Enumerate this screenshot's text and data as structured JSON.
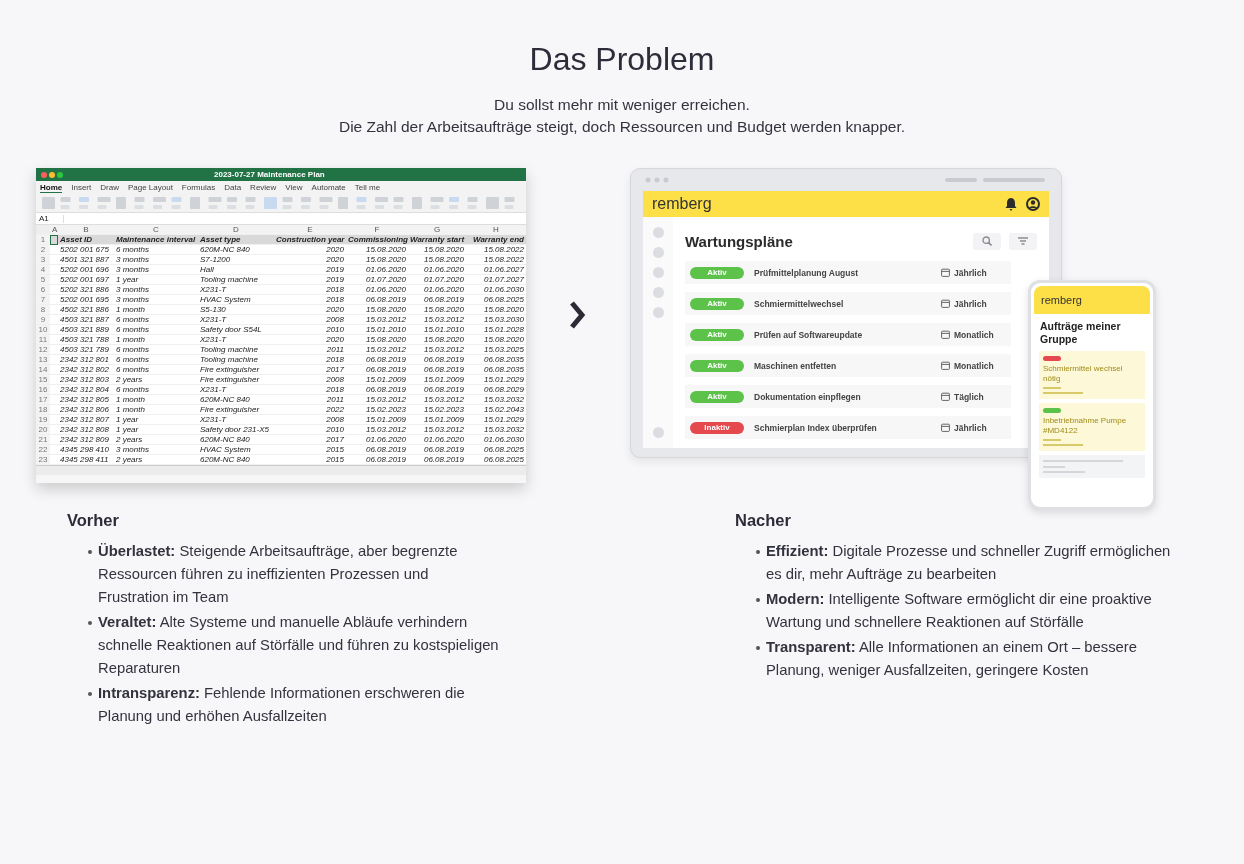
{
  "heading": "Das Problem",
  "intro": [
    "Du sollst mehr mit weniger erreichen.",
    "Die Zahl der Arbeitsaufträge steigt, doch Ressourcen und Budget werden knapper."
  ],
  "spreadsheet": {
    "title": "2023-07-27 Maintenance Plan",
    "ribbon_tabs": [
      {
        "label": "Home",
        "selected": true
      },
      {
        "label": "Insert",
        "selected": false
      },
      {
        "label": "Draw",
        "selected": false
      },
      {
        "label": "Page Layout",
        "selected": false
      },
      {
        "label": "Formulas",
        "selected": false
      },
      {
        "label": "Data",
        "selected": false
      },
      {
        "label": "Review",
        "selected": false
      },
      {
        "label": "View",
        "selected": false
      },
      {
        "label": "Automate",
        "selected": false
      },
      {
        "label": "Tell me",
        "selected": false
      }
    ],
    "cell_ref": "A1",
    "columns": [
      "A",
      "B",
      "C",
      "D",
      "E",
      "F",
      "G",
      "H"
    ],
    "header": {
      "number": "1",
      "cells": [
        "",
        "Asset ID",
        "Maintenance interval",
        "Asset type",
        "Construction year",
        "Commissioning",
        "Warranty start",
        "Warranty end"
      ]
    },
    "rows": [
      {
        "number": "2",
        "cells": [
          "",
          "5202 001 675",
          "6 months",
          "620M-NC 840",
          "2020",
          "15.08.2020",
          "15.08.2020",
          "15.08.2022"
        ]
      },
      {
        "number": "3",
        "cells": [
          "",
          "4501 321 887",
          "3 months",
          "S7-1200",
          "2020",
          "15.08.2020",
          "15.08.2020",
          "15.08.2022"
        ]
      },
      {
        "number": "4",
        "cells": [
          "",
          "5202 001 696",
          "3 months",
          "Hall",
          "2019",
          "01.06.2020",
          "01.06.2020",
          "01.06.2027"
        ]
      },
      {
        "number": "5",
        "cells": [
          "",
          "5202 001 697",
          "1 year",
          "Tooling machine",
          "2019",
          "01.07.2020",
          "01.07.2020",
          "01.07.2027"
        ]
      },
      {
        "number": "6",
        "cells": [
          "",
          "5202 321 886",
          "3 months",
          "X231-T",
          "2018",
          "01.06.2020",
          "01.06.2020",
          "01.06.2030"
        ]
      },
      {
        "number": "7",
        "cells": [
          "",
          "5202 001 695",
          "3 months",
          "HVAC System",
          "2018",
          "06.08.2019",
          "06.08.2019",
          "06.08.2025"
        ]
      },
      {
        "number": "8",
        "cells": [
          "",
          "4502 321 886",
          "1 month",
          "S5-130",
          "2020",
          "15.08.2020",
          "15.08.2020",
          "15.08.2020"
        ]
      },
      {
        "number": "9",
        "cells": [
          "",
          "4503 321 887",
          "6 months",
          "X231-T",
          "2008",
          "15.03.2012",
          "15.03.2012",
          "15.03.2030"
        ]
      },
      {
        "number": "10",
        "cells": [
          "",
          "4503 321 889",
          "6 months",
          "Safety door S54L",
          "2010",
          "15.01.2010",
          "15.01.2010",
          "15.01.2028"
        ]
      },
      {
        "number": "11",
        "cells": [
          "",
          "4503 321 788",
          "1 month",
          "X231-T",
          "2020",
          "15.08.2020",
          "15.08.2020",
          "15.08.2020"
        ]
      },
      {
        "number": "12",
        "cells": [
          "",
          "4503 321 789",
          "6 months",
          "Tooling machine",
          "2011",
          "15.03.2012",
          "15.03.2012",
          "15.03.2025"
        ]
      },
      {
        "number": "13",
        "cells": [
          "",
          "2342 312 801",
          "6 months",
          "Tooling machine",
          "2018",
          "06.08.2019",
          "06.08.2019",
          "06.08.2035"
        ]
      },
      {
        "number": "14",
        "cells": [
          "",
          "2342 312 802",
          "6 months",
          "Fire extinguisher",
          "2017",
          "06.08.2019",
          "06.08.2019",
          "06.08.2035"
        ]
      },
      {
        "number": "15",
        "cells": [
          "",
          "2342 312 803",
          "2 years",
          "Fire extinguisher",
          "2008",
          "15.01.2009",
          "15.01.2009",
          "15.01.2029"
        ]
      },
      {
        "number": "16",
        "cells": [
          "",
          "2342 312 804",
          "6 months",
          "X231-T",
          "2018",
          "06.08.2019",
          "06.08.2019",
          "06.08.2029"
        ]
      },
      {
        "number": "17",
        "cells": [
          "",
          "2342 312 805",
          "1 month",
          "620M-NC 840",
          "2011",
          "15.03.2012",
          "15.03.2012",
          "15.03.2032"
        ]
      },
      {
        "number": "18",
        "cells": [
          "",
          "2342 312 806",
          "1 month",
          "Fire extinguisher",
          "2022",
          "15.02.2023",
          "15.02.2023",
          "15.02.2043"
        ]
      },
      {
        "number": "19",
        "cells": [
          "",
          "2342 312 807",
          "1 year",
          "X231-T",
          "2008",
          "15.01.2009",
          "15.01.2009",
          "15.01.2029"
        ]
      },
      {
        "number": "20",
        "cells": [
          "",
          "2342 312 808",
          "1 year",
          "Safety door 231-X5",
          "2010",
          "15.03.2012",
          "15.03.2012",
          "15.03.2032"
        ]
      },
      {
        "number": "21",
        "cells": [
          "",
          "2342 312 809",
          "2 years",
          "620M-NC 840",
          "2017",
          "01.06.2020",
          "01.06.2020",
          "01.06.2030"
        ]
      },
      {
        "number": "22",
        "cells": [
          "",
          "4345 298 410",
          "3 months",
          "HVAC System",
          "2015",
          "06.08.2019",
          "06.08.2019",
          "06.08.2025"
        ]
      },
      {
        "number": "23",
        "cells": [
          "",
          "4345 298 411",
          "2 years",
          "620M-NC 840",
          "2015",
          "06.08.2019",
          "06.08.2019",
          "06.08.2025"
        ]
      }
    ]
  },
  "app_mockup": {
    "brand": "remberg",
    "title": "Wartungspläne",
    "plans": [
      {
        "status": "Aktiv",
        "active": true,
        "name": "Prüfmittelplanung August",
        "frequency": "Jährlich"
      },
      {
        "status": "Aktiv",
        "active": true,
        "name": "Schmiermittelwechsel",
        "frequency": "Jährlich"
      },
      {
        "status": "Aktiv",
        "active": true,
        "name": "Prüfen auf Softwareupdate",
        "frequency": "Monatlich"
      },
      {
        "status": "Aktiv",
        "active": true,
        "name": "Maschinen entfetten",
        "frequency": "Monatlich"
      },
      {
        "status": "Aktiv",
        "active": true,
        "name": "Dokumentation einpflegen",
        "frequency": "Täglich"
      },
      {
        "status": "Inaktiv",
        "active": false,
        "name": "Schmierplan Index überprüfen",
        "frequency": "Jährlich"
      }
    ],
    "phone": {
      "brand": "remberg",
      "title": "Aufträge meiner Gruppe",
      "orders": [
        {
          "color": "#e5484d",
          "title": "Schmiermittel wechsel nötig"
        },
        {
          "color": "#5cc24a",
          "title": "Inbetriebnahme Pumpe #MD4122"
        }
      ]
    }
  },
  "columns": [
    {
      "title": "Vorher",
      "points": [
        "**Überlastet:** Steigende Arbeitsaufträge, aber begrenzte Ressourcen führen zu ineffizienten Prozessen und Frustration im Team",
        "**Veraltet:** Alte Systeme und manuelle Abläufe verhindern schnelle Reaktionen auf Störfälle und führen zu kostspieligen Reparaturen",
        "**Intransparenz:** Fehlende Informationen erschweren die Planung und erhöhen Ausfallzeiten"
      ]
    },
    {
      "title": "Nacher",
      "points": [
        "**Effizient:** Digitale Prozesse und schneller Zugriff ermöglichen es dir, mehr Aufträge zu bearbeiten",
        "**Modern:** Intelligente Software ermöglicht dir eine proaktive Wartung und schnellere Reaktionen auf Störfälle",
        "**Transparent:** Alle Informationen an einem Ort – bessere Planung, weniger Ausfallzeiten, geringere Kosten"
      ]
    }
  ]
}
